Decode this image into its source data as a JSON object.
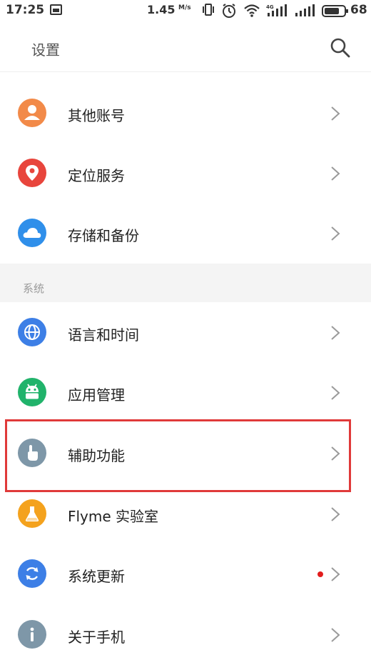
{
  "status_bar": {
    "time": "17:25",
    "speed": "1.45",
    "speed_unit": "M/s",
    "battery": "68"
  },
  "header": {
    "title": "设置",
    "search_icon": "search-icon"
  },
  "section_system": "系统",
  "items": [
    {
      "label": "其他账号",
      "icon": "account-icon",
      "color": "#f28a49"
    },
    {
      "label": "定位服务",
      "icon": "location-pin-icon",
      "color": "#e8453c"
    },
    {
      "label": "存储和备份",
      "icon": "cloud-icon",
      "color": "#2f8fea"
    },
    {
      "label": "语言和时间",
      "icon": "globe-icon",
      "color": "#3d7fe6"
    },
    {
      "label": "应用管理",
      "icon": "android-icon",
      "color": "#21b36b"
    },
    {
      "label": "辅助功能",
      "icon": "hand-pointer-icon",
      "color": "#7e97a8"
    },
    {
      "label": "Flyme 实验室",
      "icon": "flask-icon",
      "color": "#f4a21d"
    },
    {
      "label": "系统更新",
      "icon": "refresh-icon",
      "color": "#3d7fe6",
      "badge": true
    },
    {
      "label": "关于手机",
      "icon": "info-icon",
      "color": "#7e97a8"
    }
  ],
  "highlight_color": "#e03a3a"
}
